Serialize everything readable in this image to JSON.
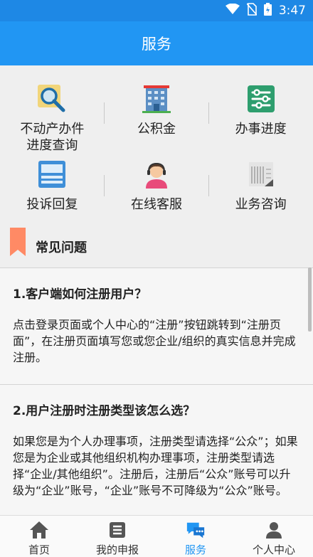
{
  "status": {
    "time": "3:47"
  },
  "header": {
    "title": "服务"
  },
  "services": [
    {
      "label_line1": "不动产办件",
      "label_line2": "进度查询",
      "icon": "search-icon"
    },
    {
      "label_line1": "公积金",
      "label_line2": "",
      "icon": "building-icon"
    },
    {
      "label_line1": "办事进度",
      "label_line2": "",
      "icon": "progress-icon"
    },
    {
      "label_line1": "投诉回复",
      "label_line2": "",
      "icon": "keyboard-icon"
    },
    {
      "label_line1": "在线客服",
      "label_line2": "",
      "icon": "agent-icon"
    },
    {
      "label_line1": "业务咨询",
      "label_line2": "",
      "icon": "document-icon"
    }
  ],
  "faq": {
    "title": "常见问题",
    "items": [
      {
        "q": "1.客户端如何注册用户？",
        "a": "点击登录页面或个人中心的“注册”按钮跳转到“注册页面”，在注册页面填写您或您企业/组织的真实信息并完成注册。"
      },
      {
        "q": "2.用户注册时注册类型该怎么选？",
        "a": "如果您是为个人办理事项，注册类型请选择“公众”；如果您是为企业或其他组织机构办理事项，注册类型请选择“企业/其他组织”。注册后，注册后“公众”账号可以升级为“企业”账号，“企业”账号不可降级为“公众”账号。"
      }
    ]
  },
  "tabs": [
    {
      "label": "首页",
      "icon": "home-icon",
      "active": false
    },
    {
      "label": "我的申报",
      "icon": "list-icon",
      "active": false
    },
    {
      "label": "服务",
      "icon": "chat-icon",
      "active": true
    },
    {
      "label": "个人中心",
      "icon": "person-icon",
      "active": false
    }
  ],
  "colors": {
    "primary": "#2196f3",
    "status": "#1e88e5",
    "accent": "#ff8a65"
  }
}
